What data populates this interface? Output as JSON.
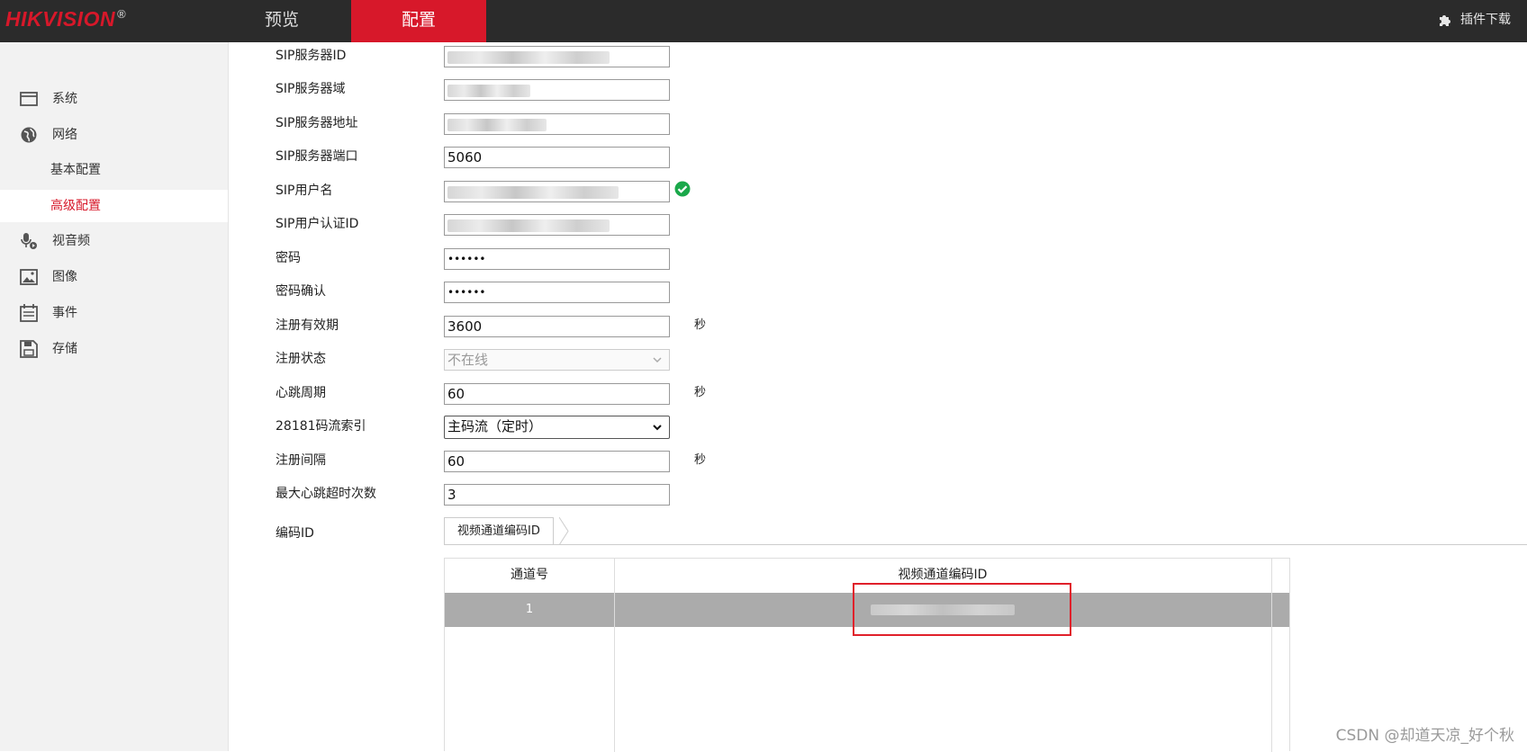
{
  "topbar": {
    "logo": "HIKVISION",
    "logo_mark": "®",
    "tabs": {
      "preview": "预览",
      "config": "配置"
    },
    "plugin_label": "插件下载",
    "active_color": "#d7182a"
  },
  "sidebar": {
    "items": {
      "system": "系统",
      "network": "网络",
      "basic_config": "基本配置",
      "advanced_config": "高级配置",
      "audio_video": "视音频",
      "image": "图像",
      "event": "事件",
      "storage": "存储"
    }
  },
  "form": {
    "sip_server_id": {
      "label": "SIP服务器ID",
      "value": ""
    },
    "sip_server_domain": {
      "label": "SIP服务器域",
      "value": ""
    },
    "sip_server_address": {
      "label": "SIP服务器地址",
      "value": ""
    },
    "sip_server_port": {
      "label": "SIP服务器端口",
      "value": "5060"
    },
    "sip_username": {
      "label": "SIP用户名",
      "value": ""
    },
    "sip_auth_id": {
      "label": "SIP用户认证ID",
      "value": ""
    },
    "password": {
      "label": "密码",
      "value": "••••••"
    },
    "password_confirm": {
      "label": "密码确认",
      "value": "••••••"
    },
    "register_validity": {
      "label": "注册有效期",
      "value": "3600",
      "unit": "秒"
    },
    "register_status": {
      "label": "注册状态",
      "value": "不在线"
    },
    "heartbeat_period": {
      "label": "心跳周期",
      "value": "60",
      "unit": "秒"
    },
    "stream_index": {
      "label": "28181码流索引",
      "value": "主码流（定时）"
    },
    "register_interval": {
      "label": "注册间隔",
      "value": "60",
      "unit": "秒"
    },
    "max_heartbeat_timeout": {
      "label": "最大心跳超时次数",
      "value": "3"
    },
    "encode_id": {
      "label": "编码ID"
    }
  },
  "encode_tab": {
    "label": "视频通道编码ID"
  },
  "table": {
    "headers": {
      "channel": "通道号",
      "encode_id": "视频通道编码ID"
    },
    "rows": [
      {
        "channel": "1",
        "encode_id": ""
      }
    ]
  },
  "watermark": "CSDN @却道天凉_好个秋",
  "colors": {
    "highlight_row": "#ababab",
    "status_ok": "#1aa84a",
    "annotation_box": "#e0202a"
  }
}
